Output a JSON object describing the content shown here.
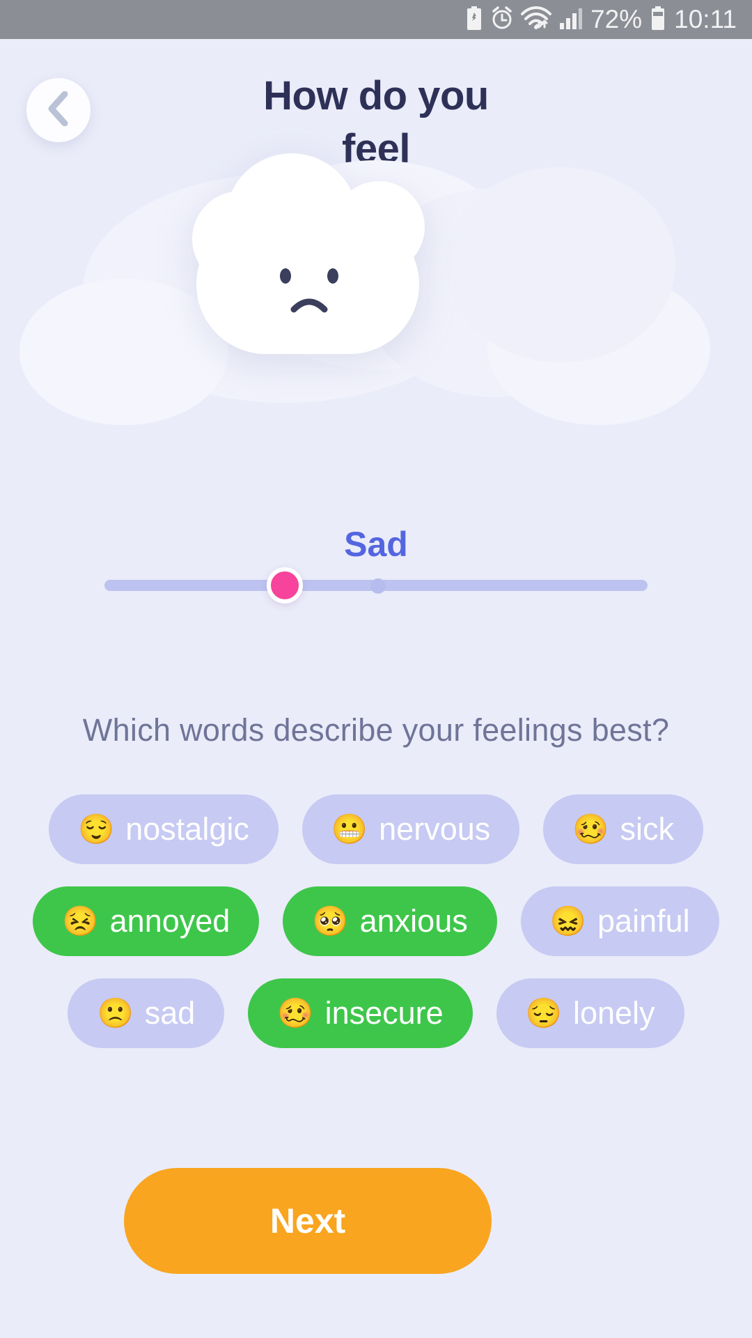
{
  "status_bar": {
    "battery_percent": "72%",
    "time": "10:11",
    "icons": [
      "battery-saver-icon",
      "alarm-icon",
      "wifi-icon",
      "signal-icon",
      "battery-icon"
    ],
    "background": "#8c8e96"
  },
  "header": {
    "title": "How do you\nfeel",
    "title_line1": "How do you",
    "title_line2": "feel",
    "back_icon": "chevron-left-icon",
    "title_color": "#2e3157"
  },
  "illustration": {
    "name": "sad-cloud-illustration",
    "expression": "sad"
  },
  "mood": {
    "label": "Sad",
    "label_color": "#5465e0",
    "slider": {
      "thumb_color": "#f7439b",
      "track_color": "#bcc3f0",
      "value_percent": 30
    }
  },
  "prompt": {
    "question": "Which words describe your feelings best?",
    "color": "#6f7498"
  },
  "feelings": {
    "selected_color": "#3ec64a",
    "unselected_color": "#c7caf2",
    "rows": [
      [
        {
          "emoji": "😌",
          "emoji_name": "relieved-face-emoji",
          "label": "nostalgic",
          "selected": false
        },
        {
          "emoji": "😬",
          "emoji_name": "grimacing-face-emoji",
          "label": "nervous",
          "selected": false
        },
        {
          "emoji": "🥴",
          "emoji_name": "woozy-face-emoji",
          "label": "sick",
          "selected": false
        }
      ],
      [
        {
          "emoji": "😣",
          "emoji_name": "persevering-face-emoji",
          "label": "annoyed",
          "selected": true
        },
        {
          "emoji": "🥺",
          "emoji_name": "pleading-face-emoji",
          "label": "anxious",
          "selected": true
        },
        {
          "emoji": "😖",
          "emoji_name": "confounded-face-emoji",
          "label": "painful",
          "selected": false
        }
      ],
      [
        {
          "emoji": "🙁",
          "emoji_name": "slightly-frowning-face-emoji",
          "label": "sad",
          "selected": false
        },
        {
          "emoji": "🥴",
          "emoji_name": "woozy-face-emoji",
          "label": "insecure",
          "selected": true
        },
        {
          "emoji": "😔",
          "emoji_name": "pensive-face-emoji",
          "label": "lonely",
          "selected": false
        }
      ]
    ]
  },
  "footer": {
    "next_label": "Next",
    "next_color": "#f9a51f"
  }
}
